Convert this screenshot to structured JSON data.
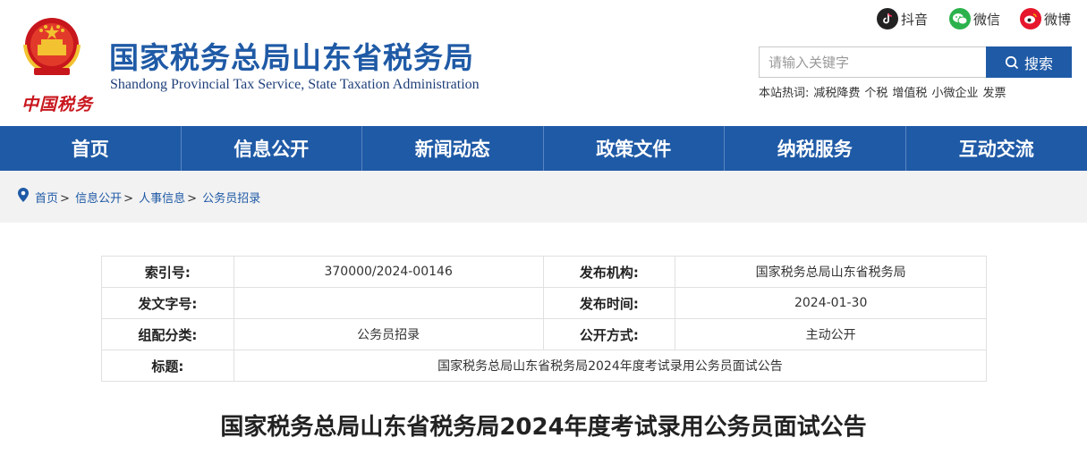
{
  "header": {
    "title": "国家税务总局山东省税务局",
    "subtitle": "Shandong Provincial Tax Service, State Taxation Administration",
    "brand_script": "中国税务",
    "emblem_icon": "national-emblem-icon",
    "social": [
      {
        "label": "抖音",
        "icon": "douyin-icon",
        "color": "#222222"
      },
      {
        "label": "微信",
        "icon": "wechat-icon",
        "color": "#2bb24c"
      },
      {
        "label": "微博",
        "icon": "weibo-icon",
        "color": "#e6162d"
      }
    ],
    "search": {
      "placeholder": "请输入关键字",
      "button_label": "搜索"
    },
    "hotwords": {
      "label": "本站热词:",
      "items": [
        "减税降费",
        "个税",
        "增值税",
        "小微企业",
        "发票"
      ]
    }
  },
  "nav": {
    "items": [
      "首页",
      "信息公开",
      "新闻动态",
      "政策文件",
      "纳税服务",
      "互动交流"
    ]
  },
  "breadcrumb": {
    "items": [
      "首页",
      "信息公开",
      "人事信息"
    ],
    "separator": ">",
    "current": "公务员招录"
  },
  "info": {
    "index_label": "索引号:",
    "index_value": "370000/2024-00146",
    "org_label": "发布机构:",
    "org_value": "国家税务总局山东省税务局",
    "doc_label": "发文字号:",
    "doc_value": "",
    "date_label": "发布时间:",
    "date_value": "2024-01-30",
    "category_label": "组配分类:",
    "category_value": "公务员招录",
    "mode_label": "公开方式:",
    "mode_value": "主动公开",
    "title_label": "标题:",
    "title_value": "国家税务总局山东省税务局2024年度考试录用公务员面试公告"
  },
  "article": {
    "title": "国家税务总局山东省税务局2024年度考试录用公务员面试公告"
  },
  "colors": {
    "brand_blue": "#1f5aa6",
    "brand_red": "#c8161d",
    "breadcrumb_bg": "#f2f2f2"
  }
}
